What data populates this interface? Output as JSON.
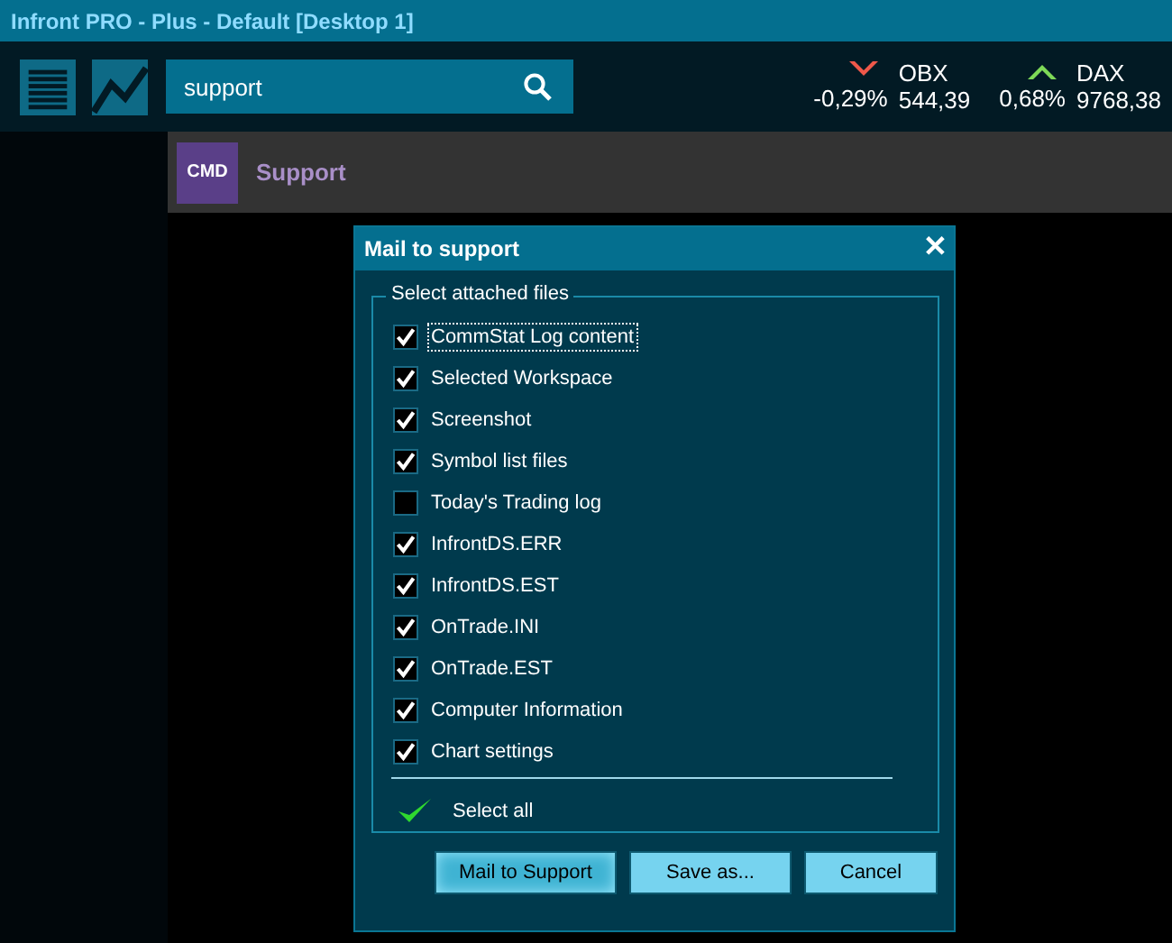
{
  "window": {
    "title": "Infront PRO - Plus - Default [Desktop 1]"
  },
  "search": {
    "value": "support"
  },
  "tickers": [
    {
      "name": "OBX",
      "change": "-0,29%",
      "price": "544,39",
      "kind": "down"
    },
    {
      "name": "DAX",
      "change": "0,68%",
      "price": "9768,38",
      "kind": "up"
    }
  ],
  "suggestion": {
    "badge": "CMD",
    "label": "Support"
  },
  "dialog": {
    "title": "Mail to support",
    "close": "✕",
    "group_label": "Select attached files",
    "files": [
      {
        "label": "CommStat Log content",
        "checked": true,
        "focused": true
      },
      {
        "label": "Selected Workspace",
        "checked": true,
        "focused": false
      },
      {
        "label": "Screenshot",
        "checked": true,
        "focused": false
      },
      {
        "label": "Symbol list files",
        "checked": true,
        "focused": false
      },
      {
        "label": "Today's Trading log",
        "checked": false,
        "focused": false
      },
      {
        "label": "InfrontDS.ERR",
        "checked": true,
        "focused": false
      },
      {
        "label": "InfrontDS.EST",
        "checked": true,
        "focused": false
      },
      {
        "label": "OnTrade.INI",
        "checked": true,
        "focused": false
      },
      {
        "label": "OnTrade.EST",
        "checked": true,
        "focused": false
      },
      {
        "label": "Computer Information",
        "checked": true,
        "focused": false
      },
      {
        "label": "Chart settings",
        "checked": true,
        "focused": false
      }
    ],
    "select_all": "Select all",
    "buttons": [
      {
        "label": "Mail to Support",
        "default": true
      },
      {
        "label": "Save as...",
        "default": false
      },
      {
        "label": "Cancel",
        "default": false
      }
    ]
  }
}
